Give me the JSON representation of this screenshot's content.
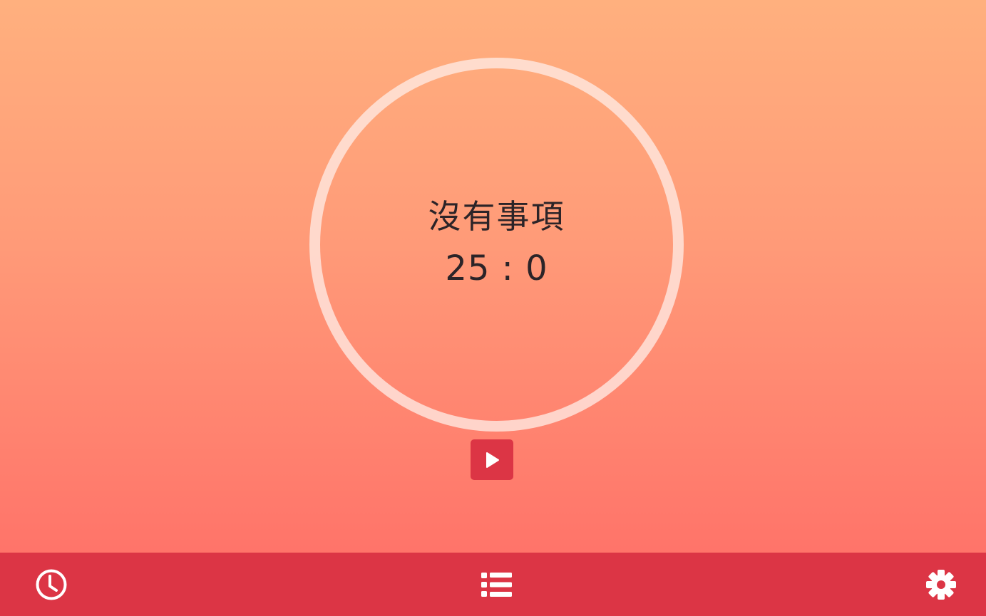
{
  "timer": {
    "task_name": "沒有事項",
    "time": "25 : 0",
    "ring_color": "#ffebe4"
  },
  "controls": {
    "play_icon": "play-icon",
    "accent": "#dc3545"
  },
  "bottom_nav": {
    "items": [
      {
        "icon": "clock-icon"
      },
      {
        "icon": "list-icon"
      },
      {
        "icon": "gear-icon"
      }
    ],
    "background": "#dc3545"
  }
}
